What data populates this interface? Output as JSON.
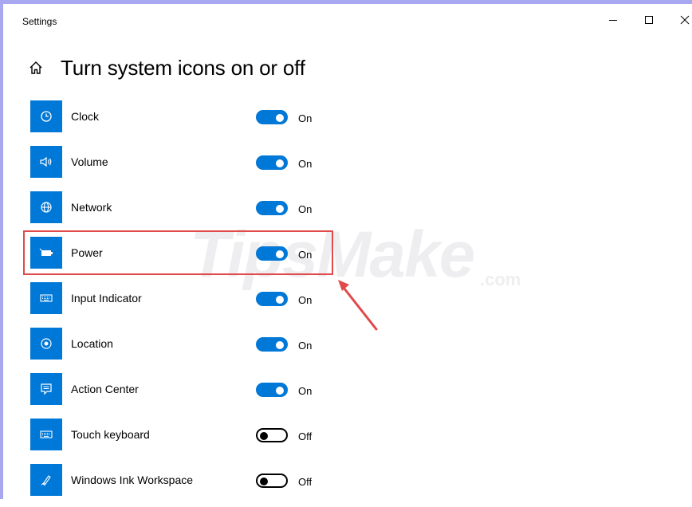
{
  "window": {
    "title": "Settings"
  },
  "header": {
    "title": "Turn system icons on or off",
    "home_icon": "home-icon"
  },
  "colors": {
    "accent": "#0078d7",
    "highlight": "#e04a4a",
    "window_border": "#a8a8f0"
  },
  "items": [
    {
      "label": "Clock",
      "icon": "clock-icon",
      "state": "On",
      "on": true
    },
    {
      "label": "Volume",
      "icon": "volume-icon",
      "state": "On",
      "on": true
    },
    {
      "label": "Network",
      "icon": "network-icon",
      "state": "On",
      "on": true
    },
    {
      "label": "Power",
      "icon": "battery-icon",
      "state": "On",
      "on": true
    },
    {
      "label": "Input Indicator",
      "icon": "keyboard-icon",
      "state": "On",
      "on": true
    },
    {
      "label": "Location",
      "icon": "location-icon",
      "state": "On",
      "on": true
    },
    {
      "label": "Action Center",
      "icon": "action-center-icon",
      "state": "On",
      "on": true
    },
    {
      "label": "Touch keyboard",
      "icon": "touch-keyboard-icon",
      "state": "Off",
      "on": false
    },
    {
      "label": "Windows Ink Workspace",
      "icon": "pen-icon",
      "state": "Off",
      "on": false
    }
  ],
  "watermark": {
    "text": "TipsMake",
    "suffix": ".com"
  }
}
